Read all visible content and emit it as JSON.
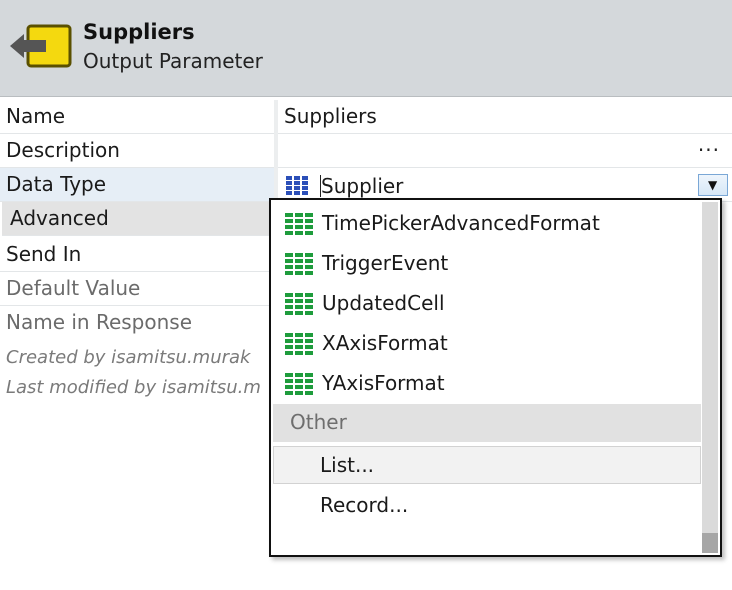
{
  "header": {
    "title": "Suppliers",
    "subtitle": "Output Parameter",
    "icon": "output-parameter-icon"
  },
  "properties": {
    "name": {
      "label": "Name",
      "value": "Suppliers"
    },
    "description": {
      "label": "Description",
      "value": "",
      "ellipsis": "..."
    },
    "data_type": {
      "label": "Data Type",
      "value": "Supplier",
      "icon": "structure-icon"
    },
    "advanced": {
      "label": "Advanced"
    },
    "send_in": {
      "label": "Send In"
    },
    "default_value": {
      "label": "Default Value"
    },
    "name_in_response": {
      "label": "Name in Response"
    }
  },
  "footer": {
    "created_by": "Created by isamitsu.murak",
    "modified_by": "Last modified by isamitsu.m"
  },
  "dropdown": {
    "items": [
      {
        "label": "TimePickerAdvancedFormat",
        "icon": "structure-icon"
      },
      {
        "label": "TriggerEvent",
        "icon": "structure-icon"
      },
      {
        "label": "UpdatedCell",
        "icon": "structure-icon"
      },
      {
        "label": "XAxisFormat",
        "icon": "structure-icon"
      },
      {
        "label": "YAxisFormat",
        "icon": "structure-icon"
      }
    ],
    "group_label": "Other",
    "list_option": "List...",
    "record_option": "Record..."
  },
  "colors": {
    "header_bg": "#d4d8db",
    "structure_icon_green": "#1e9c3c",
    "datatype_icon_blue": "#2b4fb8",
    "selected_row": "#e6eef6"
  }
}
